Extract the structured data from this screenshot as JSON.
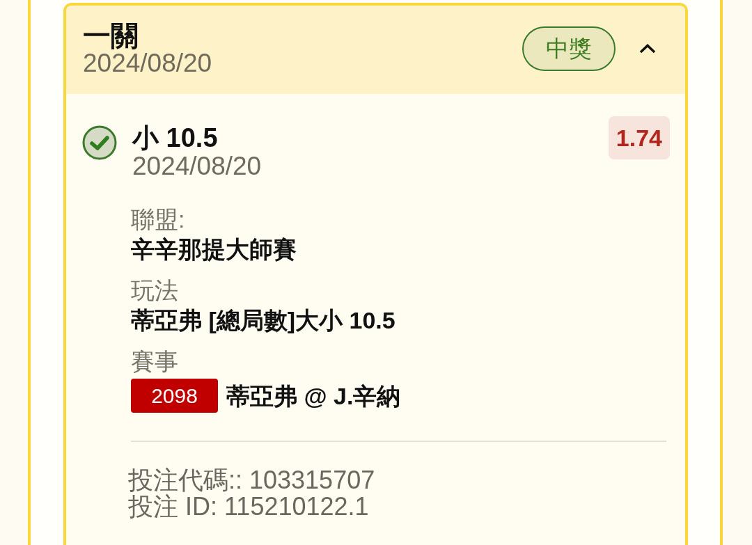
{
  "bet": {
    "title": "一關",
    "date": "2024/08/20",
    "status": {
      "label": "中獎",
      "kind": "won"
    },
    "expanded": true,
    "selection": {
      "name": "小 10.5",
      "date": "2024/08/20",
      "won": true,
      "odds": "1.74"
    },
    "details": [
      {
        "kind": "text",
        "label": "聯盟:",
        "value": "辛辛那提大師賽"
      },
      {
        "kind": "text",
        "label": "玩法",
        "value": "蒂亞弗 [總局數]大小 10.5"
      },
      {
        "kind": "event",
        "label": "賽事",
        "event_number": "2098",
        "value": "蒂亞弗 @ J.辛納"
      }
    ],
    "bet_code": "投注代碼:: 103315707",
    "bet_id": "投注 ID: 115210122.1"
  }
}
